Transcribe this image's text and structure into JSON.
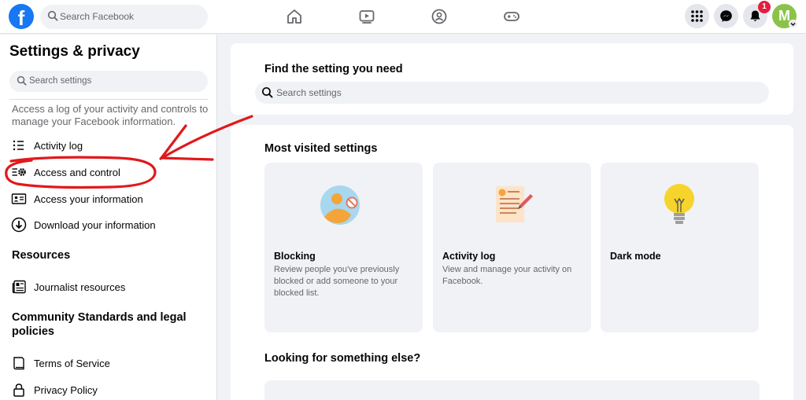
{
  "topbar": {
    "logo": "f",
    "search_placeholder": "Search Facebook",
    "nav_icons": [
      "home-icon",
      "watch-icon",
      "groups-icon",
      "gaming-icon"
    ],
    "menu_icon": "grid-menu-icon",
    "messenger_icon": "messenger-icon",
    "notifications_icon": "bell-icon",
    "notifications_count": "1",
    "avatar_initial": "M"
  },
  "sidebar": {
    "title": "Settings & privacy",
    "search_placeholder": "Search settings",
    "description": "Access a log of your activity and controls to manage your Facebook information.",
    "items": [
      {
        "label": "Activity log",
        "icon": "list-icon"
      },
      {
        "label": "Access and control",
        "icon": "settings-list-icon"
      },
      {
        "label": "Access your information",
        "icon": "id-card-icon"
      },
      {
        "label": "Download your information",
        "icon": "download-icon"
      }
    ],
    "resources_title": "Resources",
    "resources_items": [
      {
        "label": "Journalist resources",
        "icon": "newspaper-icon"
      }
    ],
    "community_title": "Community Standards and legal policies",
    "community_items": [
      {
        "label": "Terms of Service",
        "icon": "book-icon"
      },
      {
        "label": "Privacy Policy",
        "icon": "lock-icon"
      }
    ]
  },
  "main": {
    "find_title": "Find the setting you need",
    "search_placeholder": "Search settings",
    "most_visited_title": "Most visited settings",
    "tiles": [
      {
        "title": "Blocking",
        "desc": "Review people you've previously blocked or add someone to your blocked list.",
        "icon": "blocked-person-icon"
      },
      {
        "title": "Activity log",
        "desc": "View and manage your activity on Facebook.",
        "icon": "document-pencil-icon"
      },
      {
        "title": "Dark mode",
        "desc": "",
        "icon": "lightbulb-icon"
      }
    ],
    "else_title": "Looking for something else?"
  },
  "colors": {
    "brand": "#1877f2",
    "annotation": "#e0191b",
    "badge": "#e41e3f",
    "avatar": "#8bc34a"
  }
}
